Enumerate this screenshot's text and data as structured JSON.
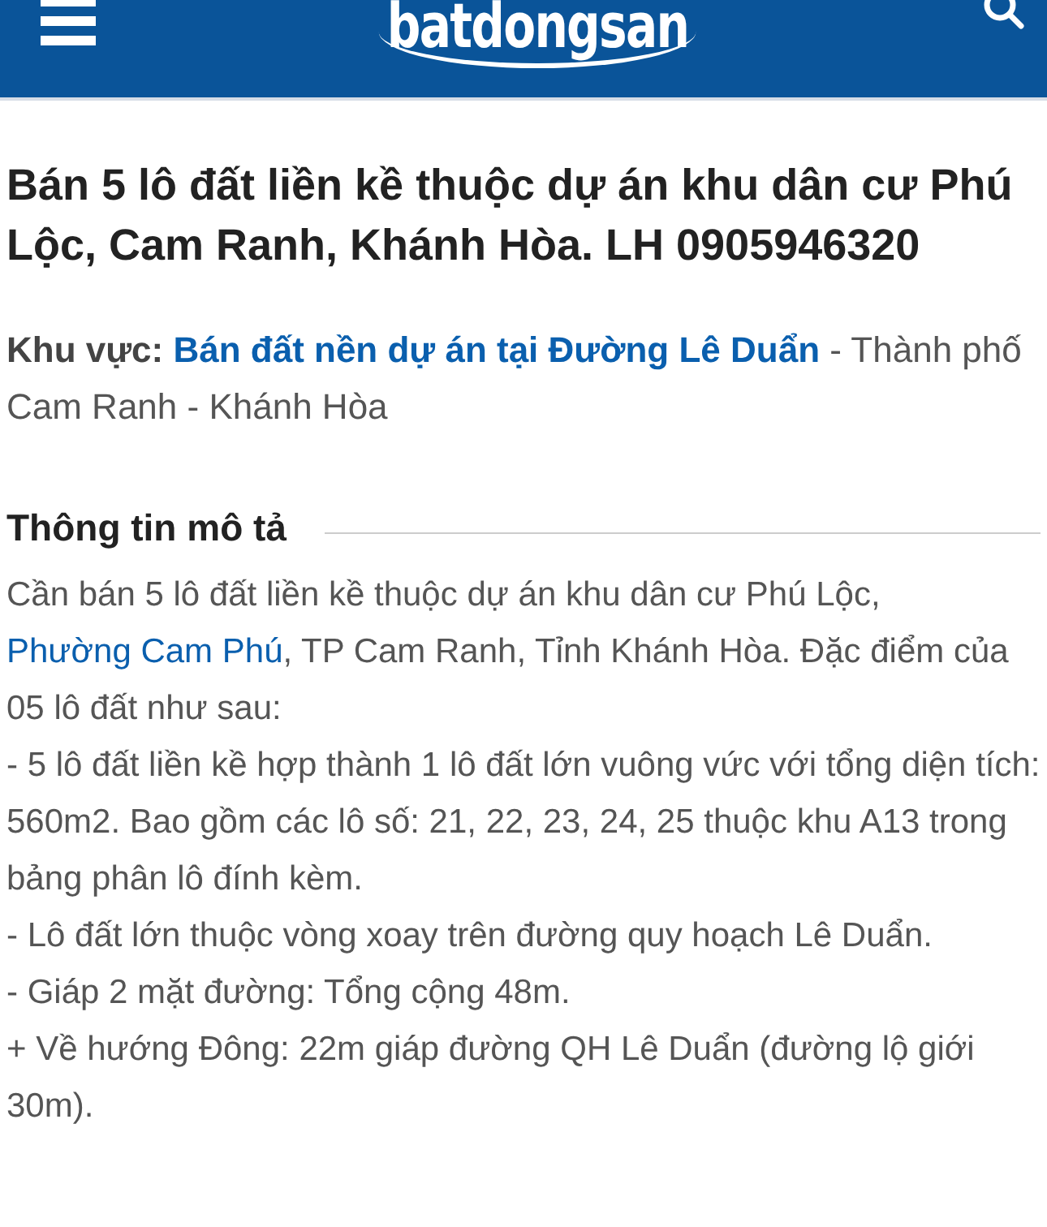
{
  "header": {
    "logo": "batdongsan"
  },
  "title": "Bán 5 lô đất liền kề thuộc dự án khu dân cư Phú Lộc, Cam Ranh, Khánh Hòa. LH 0905946320",
  "area": {
    "label": "Khu vực:",
    "link": "Bán đất nền dự án tại Đường Lê Duẩn",
    "rest": " - Thành phố Cam Ranh - Khánh Hòa"
  },
  "section": {
    "heading": "Thông tin mô tả"
  },
  "description": {
    "intro": {
      "before": "Cần bán 5 lô đất liền kề thuộc dự án khu dân cư Phú Lộc, ",
      "link": "Phường Cam Phú",
      "after": ", TP Cam Ranh, Tỉnh Khánh Hòa. Đặc điểm của 05 lô đất như sau:"
    },
    "lines": [
      "- 5 lô đất liền kề hợp thành 1 lô đất lớn vuông vức với tổng diện tích: 560m2. Bao gồm các lô số: 21, 22, 23, 24, 25 thuộc khu A13 trong bảng phân lô đính kèm.",
      "- Lô đất lớn thuộc vòng xoay trên đường quy hoạch Lê Duẩn.",
      "- Giáp 2 mặt đường: Tổng cộng 48m.",
      "+ Về hướng Đông: 22m giáp đường QH Lê Duẩn (đường lộ giới 30m)."
    ]
  }
}
